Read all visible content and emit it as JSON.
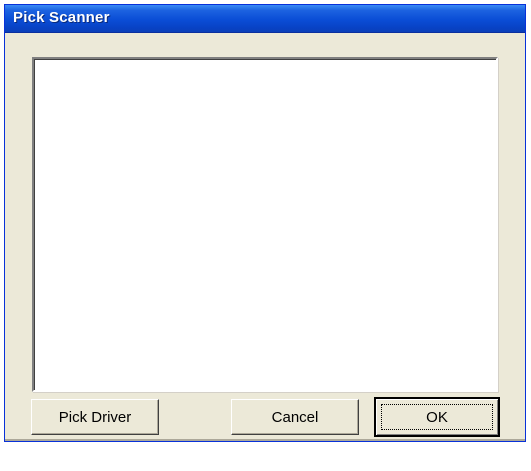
{
  "window": {
    "title": "Pick Scanner"
  },
  "scanner_list": {
    "items": []
  },
  "buttons": {
    "pick_driver": "Pick Driver",
    "cancel": "Cancel",
    "ok": "OK"
  },
  "colors": {
    "titlebar": "#0a4dd6",
    "dialog_background": "#ece9d8",
    "list_background": "#ffffff"
  }
}
